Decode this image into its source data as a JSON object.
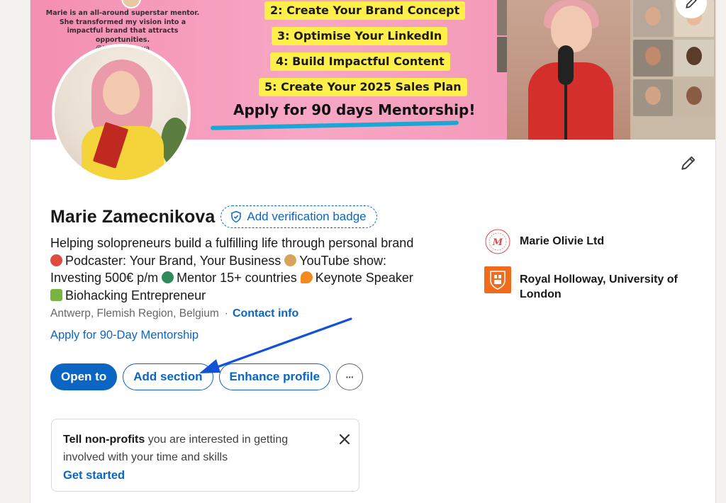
{
  "banner": {
    "quote": "Marie is an all-around superstar mentor. She transformed my vision into a impactful brand that attracts opportunities.",
    "quote_handle": "@Ivona Ivanova",
    "steps": [
      "2: Create Your Brand Concept",
      "3: Optimise Your LinkedIn",
      "4: Build Impactful Content",
      "5: Create Your 2025 Sales Plan"
    ],
    "cta": "Apply for 90 days Mentorship!"
  },
  "profile": {
    "name": "Marie Zamecnikova",
    "verification_label": "Add verification badge",
    "headline": {
      "line1": "Helping solopreneurs build a fulfilling life through personal brand",
      "p1": "Podcaster: Your Brand, Your Business",
      "p2": "YouTube show:",
      "p3": "Investing 500€ p/m",
      "p4": "Mentor 15+ countries",
      "p5": "Keynote Speaker",
      "p6": "Biohacking Entrepreneur"
    },
    "location": "Antwerp, Flemish Region, Belgium",
    "separator": "·",
    "contact_label": "Contact info",
    "link_label": "Apply for 90-Day Mentorship"
  },
  "actions": {
    "open_to": "Open to",
    "add_section": "Add section",
    "enhance_profile": "Enhance profile",
    "more": "···"
  },
  "experience": [
    {
      "name": "Marie Olivie Ltd",
      "logo_text": "OLIVIE LLC · MARIE"
    },
    {
      "name": "Royal Holloway, University of London"
    }
  ],
  "notice": {
    "bold": "Tell non-profits",
    "rest": " you are interested in getting involved with your time and skills",
    "cta": "Get started",
    "close": "✕"
  },
  "colors": {
    "accent": "#0a66c2",
    "banner_pink": "#f49ab9",
    "highlight_yellow": "#ffef4a",
    "royal_holloway_orange": "#f26b1d"
  }
}
